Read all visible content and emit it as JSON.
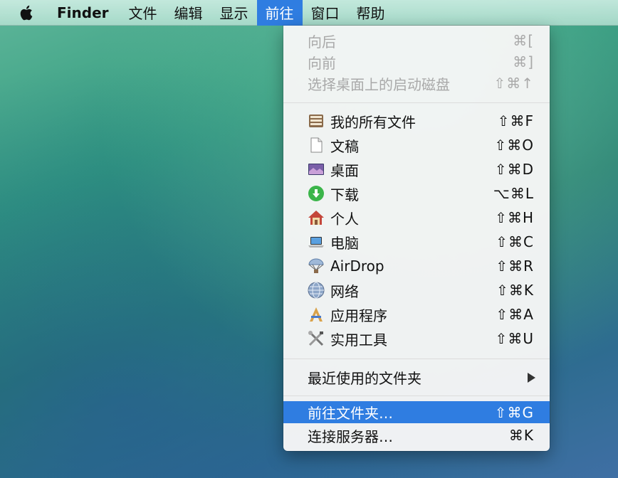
{
  "menubar": {
    "apple_icon": "apple-logo-icon",
    "items": [
      "Finder",
      "文件",
      "编辑",
      "显示",
      "前往",
      "窗口",
      "帮助"
    ],
    "active": "前往"
  },
  "go_menu": {
    "history": [
      {
        "label": "向后",
        "shortcut": "⌘[",
        "enabled": false
      },
      {
        "label": "向前",
        "shortcut": "⌘]",
        "enabled": false
      },
      {
        "label": "选择桌面上的启动磁盘",
        "shortcut": "⇧⌘↑",
        "enabled": false
      }
    ],
    "places": [
      {
        "label": "我的所有文件",
        "shortcut": "⇧⌘F",
        "icon": "all-my-files-icon"
      },
      {
        "label": "文稿",
        "shortcut": "⇧⌘O",
        "icon": "documents-icon"
      },
      {
        "label": "桌面",
        "shortcut": "⇧⌘D",
        "icon": "desktop-icon"
      },
      {
        "label": "下载",
        "shortcut": "⌥⌘L",
        "icon": "downloads-icon"
      },
      {
        "label": "个人",
        "shortcut": "⇧⌘H",
        "icon": "home-icon"
      },
      {
        "label": "电脑",
        "shortcut": "⇧⌘C",
        "icon": "computer-icon"
      },
      {
        "label": "AirDrop",
        "shortcut": "⇧⌘R",
        "icon": "airdrop-icon"
      },
      {
        "label": "网络",
        "shortcut": "⇧⌘K",
        "icon": "network-icon"
      },
      {
        "label": "应用程序",
        "shortcut": "⇧⌘A",
        "icon": "applications-icon"
      },
      {
        "label": "实用工具",
        "shortcut": "⇧⌘U",
        "icon": "utilities-icon"
      }
    ],
    "recent_folders": {
      "label": "最近使用的文件夹",
      "icon": "submenu-arrow-icon"
    },
    "goto_folder": {
      "label": "前往文件夹…",
      "shortcut": "⇧⌘G",
      "highlighted": true
    },
    "connect_server": {
      "label": "连接服务器…",
      "shortcut": "⌘K"
    }
  },
  "colors": {
    "highlight": "#2f7de1",
    "disabled_text": "#a9a9a9"
  }
}
